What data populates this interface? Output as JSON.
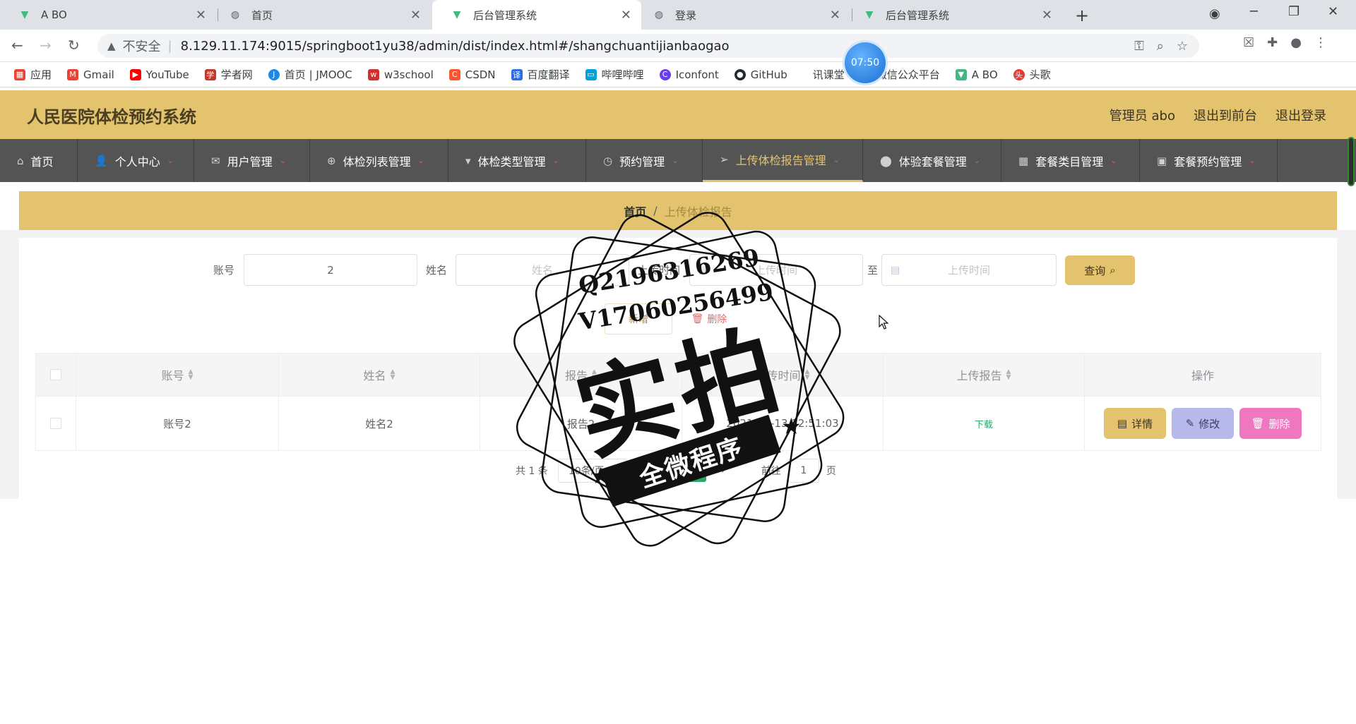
{
  "browser": {
    "tabs": [
      {
        "title": "A BO",
        "favicon": "vue-logo-icon",
        "active": false
      },
      {
        "title": "首页",
        "favicon": "globe-icon",
        "active": false
      },
      {
        "title": "后台管理系统",
        "favicon": "vue-logo-icon",
        "active": true
      },
      {
        "title": "登录",
        "favicon": "globe-icon",
        "active": false
      },
      {
        "title": "后台管理系统",
        "favicon": "vue-logo-icon",
        "active": false
      }
    ],
    "address": {
      "insecure_label": "不安全",
      "url": "8.129.11.174:9015/springboot1yu38/admin/dist/index.html#/shangchuantijianbaogao"
    },
    "bookmarks": [
      {
        "label": "应用",
        "icon": "apps-grid-icon",
        "color": "#ea4335"
      },
      {
        "label": "Gmail",
        "icon": "gmail-icon",
        "color": "#ea4335"
      },
      {
        "label": "YouTube",
        "icon": "youtube-icon",
        "color": "#ff0000"
      },
      {
        "label": "学者网",
        "icon": "scholar-icon",
        "color": "#c0392b"
      },
      {
        "label": "首页 | JMOOC",
        "icon": "jmooc-icon",
        "color": "#1e88e5"
      },
      {
        "label": "w3school",
        "icon": "w3school-icon",
        "color": "#d32f2f"
      },
      {
        "label": "CSDN",
        "icon": "csdn-icon",
        "color": "#fc5531"
      },
      {
        "label": "百度翻译",
        "icon": "baidu-translate-icon",
        "color": "#2b6de6"
      },
      {
        "label": "哔哩哔哩",
        "icon": "bilibili-icon",
        "color": "#00a1d6"
      },
      {
        "label": "Iconfont",
        "icon": "iconfont-icon",
        "color": "#6a3df0"
      },
      {
        "label": "GitHub",
        "icon": "github-icon",
        "color": "#24292e"
      },
      {
        "label": "讯课堂",
        "icon": "ketang-icon",
        "color": "#1677ff"
      },
      {
        "label": "微信公众平台",
        "icon": "wechat-icon",
        "color": "#07c160"
      },
      {
        "label": "A BO",
        "icon": "vue-logo-icon",
        "color": "#42b883"
      },
      {
        "label": "头歌",
        "icon": "touge-icon",
        "color": "#e53935"
      }
    ],
    "clock": "07:50"
  },
  "app": {
    "title": "人民医院体检预约系统",
    "header_links": [
      "管理员 abo",
      "退出到前台",
      "退出登录"
    ],
    "menu": [
      {
        "label": "首页",
        "icon": "home-icon",
        "caret": false,
        "active": false
      },
      {
        "label": "个人中心",
        "icon": "user-icon",
        "caret": true,
        "active": false
      },
      {
        "label": "用户管理",
        "icon": "mail-icon",
        "caret": true,
        "active": false
      },
      {
        "label": "体检列表管理",
        "icon": "crosshair-icon",
        "caret": true,
        "active": false
      },
      {
        "label": "体检类型管理",
        "icon": "brush-icon",
        "caret": true,
        "active": false
      },
      {
        "label": "预约管理",
        "icon": "clock-icon",
        "caret": true,
        "active": false
      },
      {
        "label": "上传体检报告管理",
        "icon": "send-icon",
        "caret": true,
        "active": true
      },
      {
        "label": "体验套餐管理",
        "icon": "pin-icon",
        "caret": true,
        "active": false
      },
      {
        "label": "套餐类目管理",
        "icon": "grid-icon",
        "caret": true,
        "active": false
      },
      {
        "label": "套餐预约管理",
        "icon": "chart-icon",
        "caret": true,
        "active": false
      }
    ],
    "breadcrumb": {
      "home": "首页",
      "separator": "/",
      "current": "上传体检报告"
    },
    "search": {
      "account_label": "账号",
      "account_value": "2",
      "name_label": "姓名",
      "name_placeholder": "姓名",
      "upload_time_label": "上传时间",
      "start_placeholder": "上传时间",
      "to_label": "至",
      "end_placeholder": "上传时间",
      "query_label": "查询"
    },
    "actions": {
      "add_label": "新增",
      "delete_label": "删除"
    },
    "table": {
      "columns": [
        "账号",
        "姓名",
        "报告",
        "上传时间",
        "上传报告",
        "操作"
      ],
      "rows": [
        {
          "account": "账号2",
          "name": "姓名2",
          "report": "报告2",
          "upload_time": "2021-03-13 12:51:03",
          "download": "下载"
        }
      ],
      "row_actions": {
        "detail": "详情",
        "edit": "修改",
        "delete": "删除"
      }
    },
    "pagination": {
      "total": "共 1 条",
      "page_size": "10条/页",
      "current_page": "1",
      "goto_label": "前往",
      "goto_value": "1",
      "page_unit": "页"
    }
  },
  "watermark": {
    "line1": "Q2196316269",
    "line2": "V17060256499",
    "big": "实拍",
    "band": "全微程序"
  }
}
